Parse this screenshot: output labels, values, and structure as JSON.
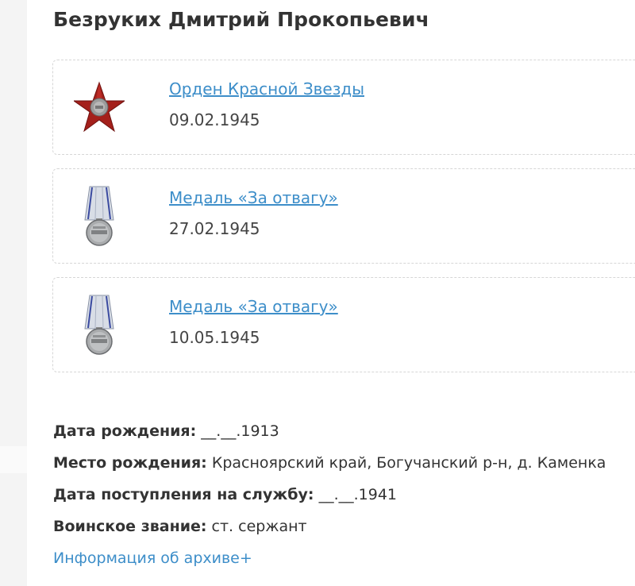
{
  "person": {
    "name": "Безруких Дмитрий Прокопьевич"
  },
  "awards": [
    {
      "name": "Орден Красной Звезды",
      "date": "09.02.1945",
      "icon": "red-star-order-icon"
    },
    {
      "name": "Медаль «За отвагу»",
      "date": "27.02.1945",
      "icon": "bravery-medal-icon"
    },
    {
      "name": "Медаль «За отвагу»",
      "date": "10.05.1945",
      "icon": "bravery-medal-icon"
    }
  ],
  "info": {
    "birth_date_label": "Дата рождения:",
    "birth_date_value": "__.__.1913",
    "birth_place_label": "Место рождения:",
    "birth_place_value": "Красноярский край, Богучанский р-н, д. Каменка",
    "service_date_label": "Дата поступления на службу:",
    "service_date_value": "__.__.1941",
    "rank_label": "Воинское звание:",
    "rank_value": "ст. сержант",
    "archive_link": "Информация об архиве+"
  },
  "colors": {
    "link": "#3d8ec9",
    "text": "#333333",
    "star": "#a4201b"
  }
}
